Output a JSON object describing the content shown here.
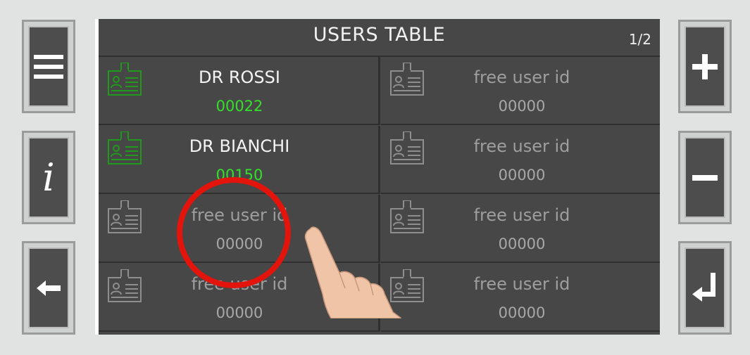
{
  "screen": {
    "title": "USERS TABLE",
    "page": "1/2"
  },
  "users": [
    {
      "name": "DR ROSSI",
      "id": "00022",
      "state": "active"
    },
    {
      "name": "free user id",
      "id": "00000",
      "state": "free"
    },
    {
      "name": "DR BIANCHI",
      "id": "00150",
      "state": "active"
    },
    {
      "name": "free user id",
      "id": "00000",
      "state": "free"
    },
    {
      "name": "free user id",
      "id": "00000",
      "state": "free"
    },
    {
      "name": "free user id",
      "id": "00000",
      "state": "free"
    },
    {
      "name": "free user id",
      "id": "00000",
      "state": "free"
    },
    {
      "name": "free user id",
      "id": "00000",
      "state": "free"
    }
  ],
  "side_buttons": {
    "left": [
      "menu-icon",
      "info-icon",
      "back-arrow-icon"
    ],
    "right": [
      "plus-icon",
      "minus-icon",
      "enter-icon"
    ]
  },
  "colors": {
    "active": "#35e02b",
    "highlight": "#e3140b",
    "screen": "#474747"
  }
}
